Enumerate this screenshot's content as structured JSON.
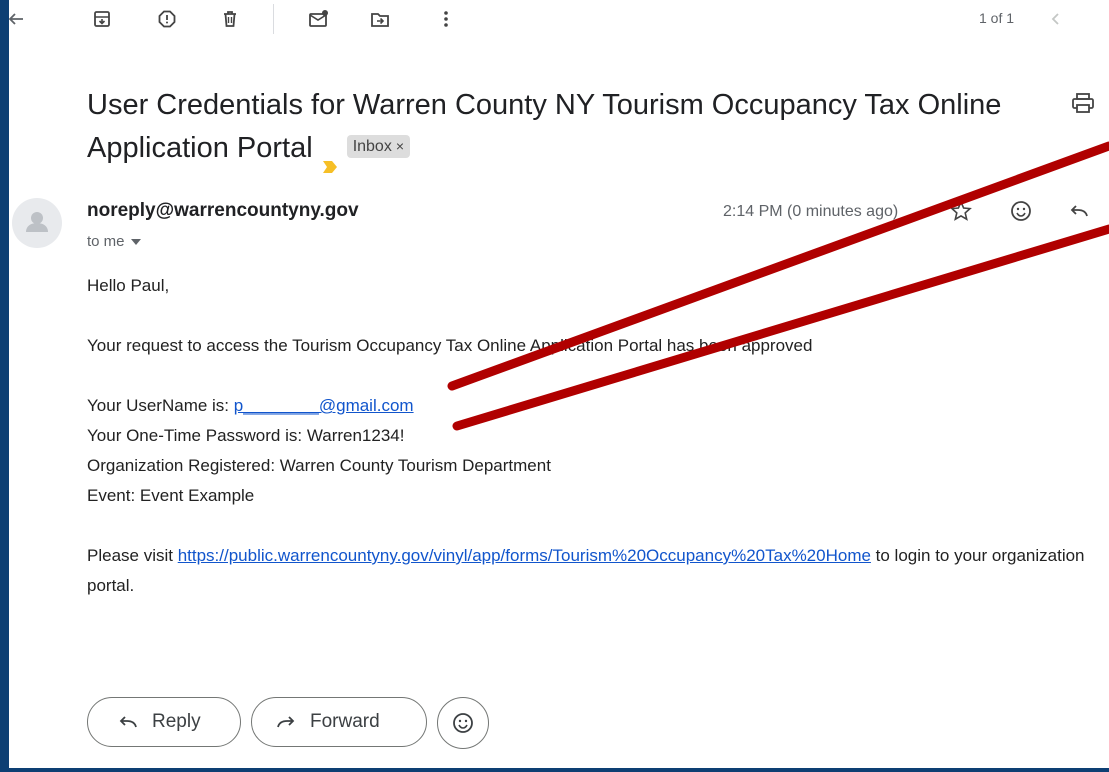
{
  "toolbar": {
    "icons": [
      "back-arrow-icon",
      "archive-icon",
      "report-spam-icon",
      "delete-icon",
      "mark-unread-icon",
      "move-to-icon",
      "more-vert-icon"
    ],
    "pager": "1 of 1"
  },
  "email": {
    "subject": "User Credentials for Warren County NY Tourism Occupancy Tax Online Application Portal",
    "label": "Inbox",
    "label_close": "×",
    "sender": "noreply@warrencountyny.gov",
    "to": "to me",
    "time": "2:14 PM (0 minutes ago)",
    "body": {
      "greeting": "Hello Paul,",
      "approved": "Your request to access the Tourism Occupancy Tax Online Application Portal has been approved",
      "username_label": "Your UserName is: ",
      "username_value": "p________@gmail.com",
      "password_line": "Your One-Time Password is: Warren1234!",
      "org_line": "Organization Registered: Warren County Tourism Department",
      "event_line": "Event: Event Example",
      "visit_prefix": "Please visit ",
      "visit_link": "https://public.warrencountyny.gov/vinyl/app/forms/Tourism%20Occupancy%20Tax%20Home",
      "visit_suffix": " to login to your organization portal."
    }
  },
  "actions": {
    "reply": "Reply",
    "forward": "Forward"
  },
  "colors": {
    "frame": "#0d3f73",
    "annotation": "#b00000",
    "link": "#1155cc",
    "important": "#f6bf26"
  }
}
